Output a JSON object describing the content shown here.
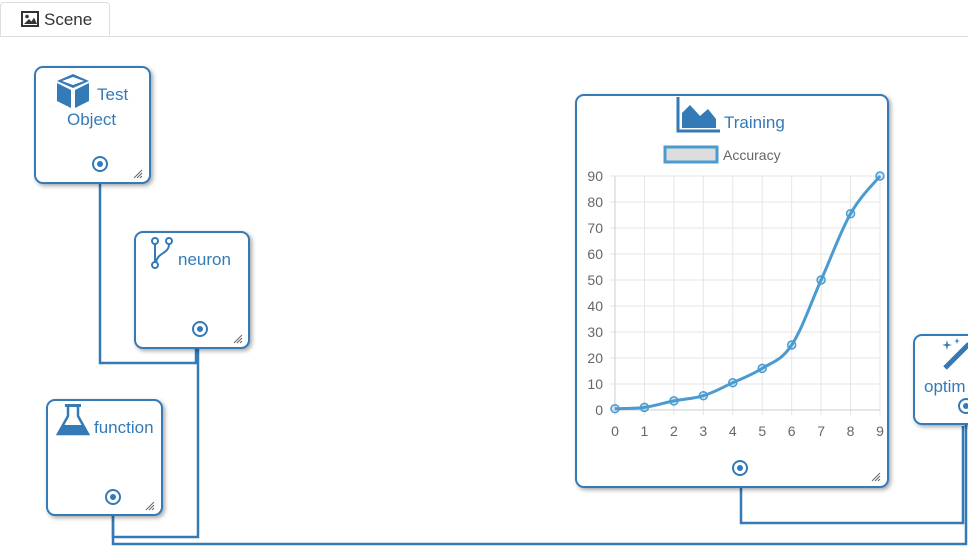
{
  "tab": {
    "label": "Scene",
    "icon": "image-icon"
  },
  "nodes": {
    "test_object": {
      "title_line1": "Test",
      "title_line2": "Object",
      "icon": "cube-icon"
    },
    "neuron": {
      "title": "neuron",
      "icon": "branch-icon"
    },
    "function": {
      "title": "function",
      "icon": "flask-icon"
    },
    "training": {
      "title": "Training",
      "icon": "area-chart-icon"
    },
    "optimizer": {
      "title": "optim",
      "icon": "magic-wand-icon"
    }
  },
  "colors": {
    "accent": "#337ab7",
    "series": "#4a9bd1",
    "legend_fill": "#dddddd"
  },
  "chart_data": {
    "type": "line",
    "legend": [
      "Accuracy"
    ],
    "x": [
      0,
      1,
      2,
      3,
      4,
      5,
      6,
      7,
      8,
      9
    ],
    "series": [
      {
        "name": "Accuracy",
        "values": [
          0.5,
          1,
          3.5,
          5.5,
          10.5,
          16,
          25,
          50,
          75.5,
          90
        ]
      }
    ],
    "xticks": [
      "0",
      "1",
      "2",
      "3",
      "4",
      "5",
      "6",
      "7",
      "8",
      "9"
    ],
    "yticks": [
      "0",
      "10",
      "20",
      "30",
      "40",
      "50",
      "60",
      "70",
      "80",
      "90"
    ],
    "ylim": [
      0,
      90
    ],
    "grid": true,
    "legend_position": "top"
  }
}
